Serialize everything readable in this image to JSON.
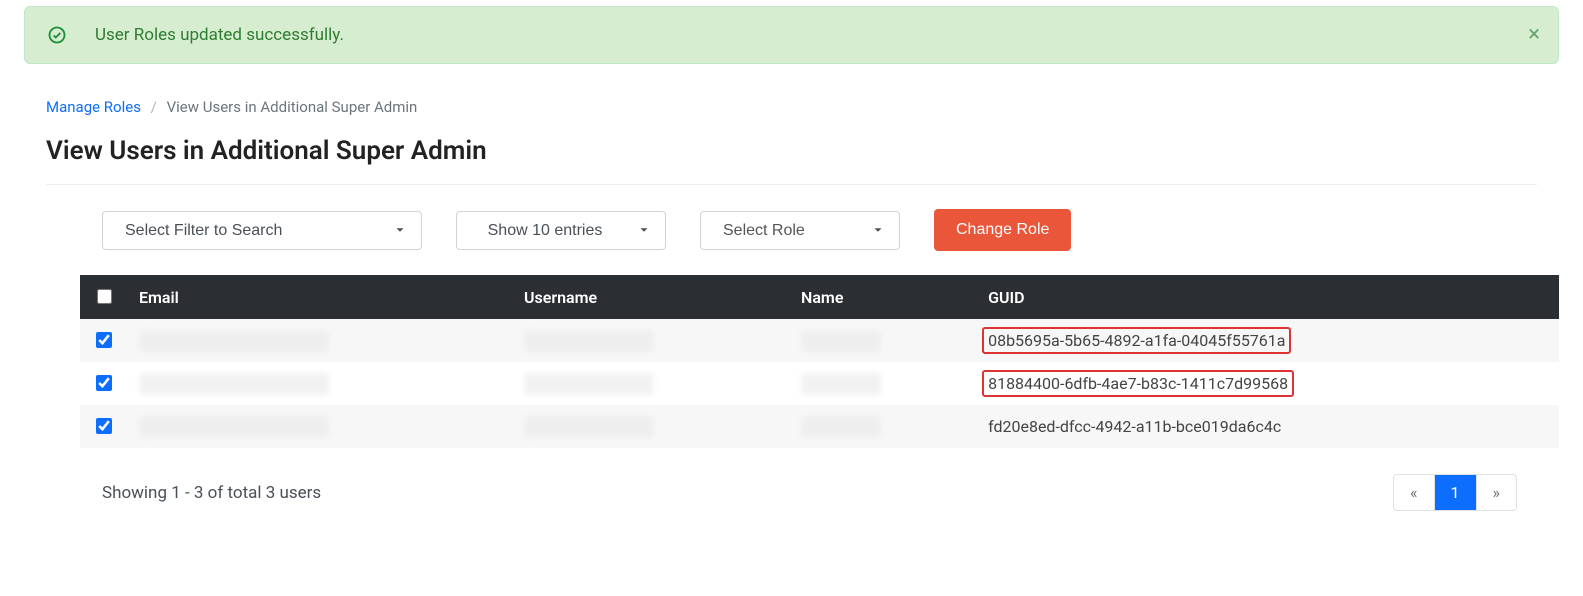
{
  "alert": {
    "message": "User Roles updated successfully."
  },
  "breadcrumb": {
    "parent": "Manage Roles",
    "current": "View Users in Additional Super Admin"
  },
  "page_title": "View Users in Additional Super Admin",
  "controls": {
    "filter_placeholder": "Select Filter to Search",
    "entries_label": "Show 10 entries",
    "role_label": "Select Role",
    "change_role_label": "Change Role"
  },
  "table": {
    "columns": {
      "email": "Email",
      "username": "Username",
      "name": "Name",
      "guid": "GUID"
    },
    "rows": [
      {
        "checked": true,
        "guid": "08b5695a-5b65-4892-a1fa-04045f55761a",
        "highlight": true
      },
      {
        "checked": true,
        "guid": "81884400-6dfb-4ae7-b83c-1411c7d99568",
        "highlight": true
      },
      {
        "checked": true,
        "guid": "fd20e8ed-dfcc-4942-a11b-bce019da6c4c",
        "highlight": false
      }
    ]
  },
  "footer": {
    "showing": "Showing 1 - 3 of total 3 users",
    "pagination": {
      "prev": "«",
      "page": "1",
      "next": "»"
    }
  }
}
